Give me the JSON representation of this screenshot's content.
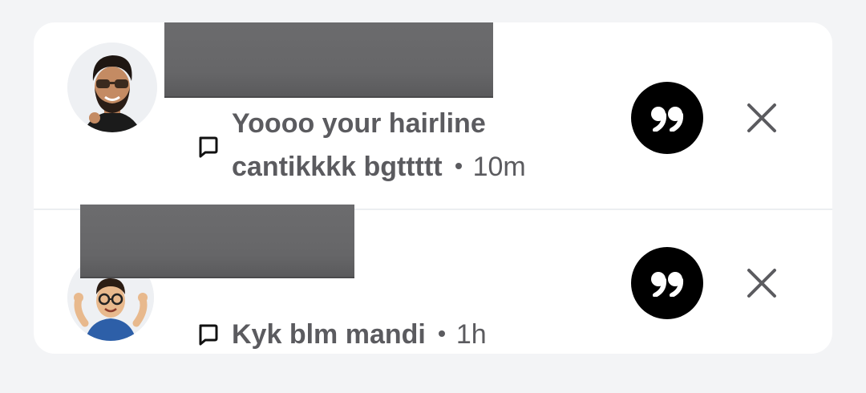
{
  "notifications": [
    {
      "avatar_icon": "bitmoji-avatar-sunglasses-beard",
      "name": "",
      "message": "Yoooo your hairline cantikkkk bgttttt",
      "time": "10m",
      "reply_icon": "chat-bubble-icon",
      "quote_icon": "quote-icon",
      "dismiss_icon": "close-icon"
    },
    {
      "avatar_icon": "bitmoji-avatar-glasses-flexing",
      "name": "",
      "message": "Kyk blm mandi",
      "time": "1h",
      "reply_icon": "chat-bubble-icon",
      "quote_icon": "quote-icon",
      "dismiss_icon": "close-icon"
    }
  ],
  "colors": {
    "background": "#f3f4f6",
    "card": "#ffffff",
    "text": "#5b5b5f",
    "quote_button": "#000000",
    "redaction": "#666668"
  }
}
